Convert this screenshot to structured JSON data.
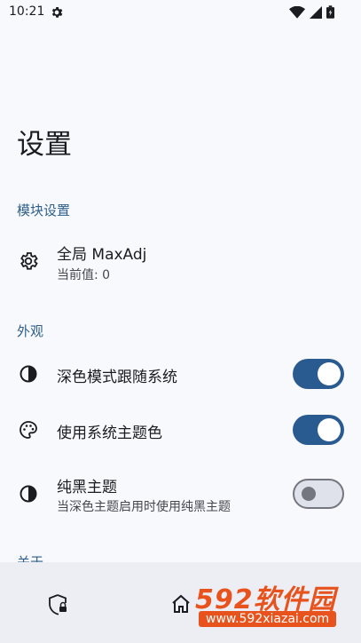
{
  "status_bar": {
    "time": "10:21"
  },
  "page": {
    "title": "设置"
  },
  "sections": {
    "module": {
      "header": "模块设置",
      "global": {
        "title": "全局 MaxAdj",
        "subtitle": "当前值: 0"
      }
    },
    "appearance": {
      "header": "外观",
      "dark_follow": {
        "title": "深色模式跟随系统",
        "enabled": true
      },
      "system_theme": {
        "title": "使用系统主题色",
        "enabled": true
      },
      "pure_black": {
        "title": "纯黑主题",
        "subtitle": "当深色主题启用时使用纯黑主题",
        "enabled": false
      }
    },
    "about": {
      "header": "关于"
    }
  },
  "colors": {
    "accent": "#2a5b90",
    "section_header": "#2e5f8a"
  },
  "watermark": {
    "brand": "592软件园",
    "url": "www.592xiazai.com"
  }
}
